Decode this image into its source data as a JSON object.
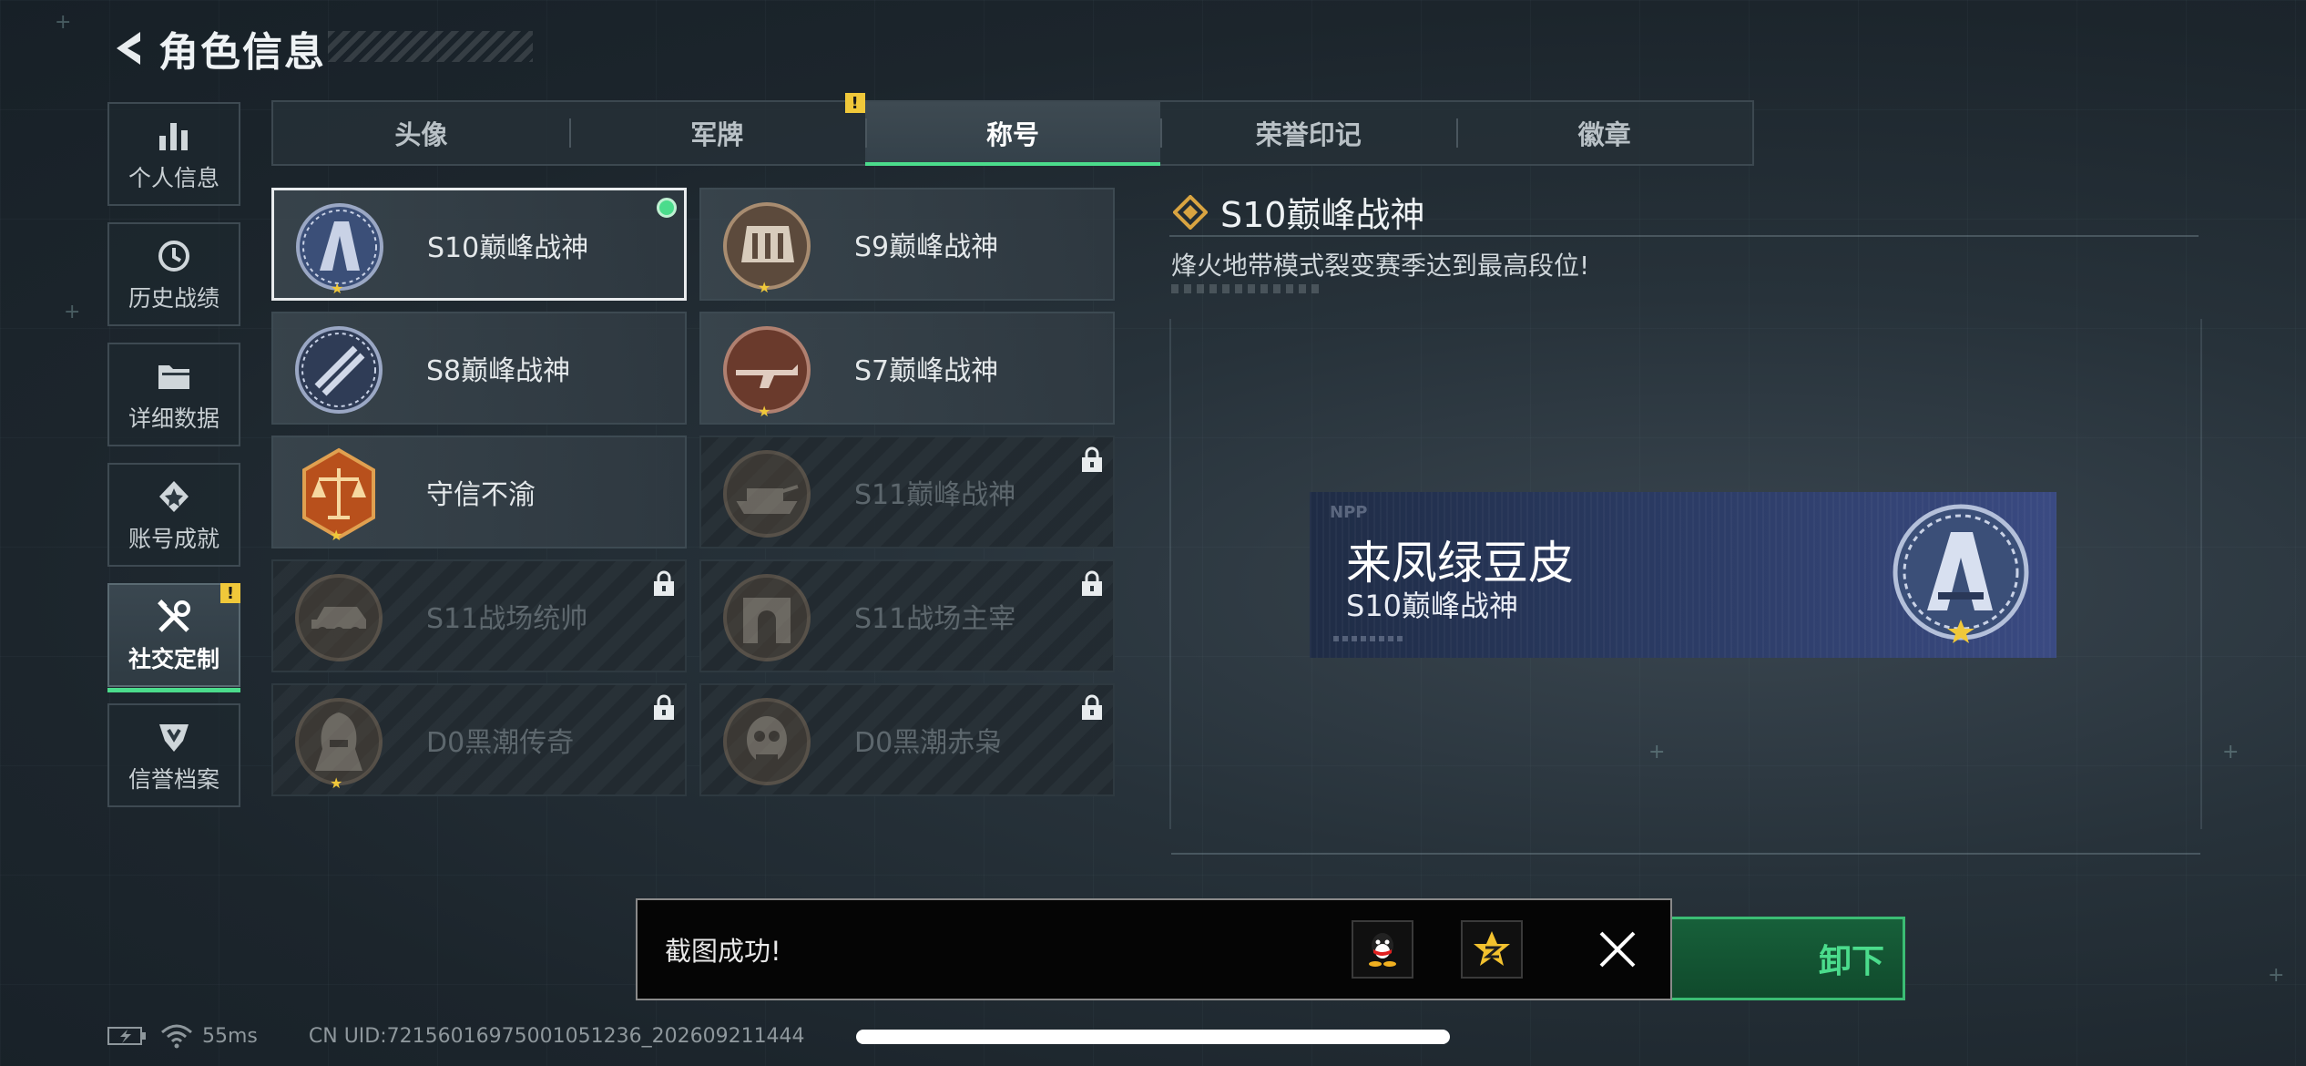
{
  "header": {
    "title": "角色信息"
  },
  "sidebar": {
    "items": [
      {
        "label": "个人信息",
        "icon": "bar-chart-icon"
      },
      {
        "label": "历史战绩",
        "icon": "clock-icon"
      },
      {
        "label": "详细数据",
        "icon": "folder-icon"
      },
      {
        "label": "账号成就",
        "icon": "achievement-icon"
      },
      {
        "label": "社交定制",
        "icon": "tools-icon",
        "active": true,
        "badge": "!"
      },
      {
        "label": "信誉档案",
        "icon": "credit-shield-icon"
      }
    ]
  },
  "tabs": [
    {
      "label": "头像"
    },
    {
      "label": "军牌",
      "badge": "!"
    },
    {
      "label": "称号",
      "active": true
    },
    {
      "label": "荣誉印记"
    },
    {
      "label": "徽章"
    }
  ],
  "titles": [
    {
      "name": "S10巅峰战神",
      "selected": true,
      "equipped": true,
      "locked": false
    },
    {
      "name": "S9巅峰战神",
      "locked": false
    },
    {
      "name": "S8巅峰战神",
      "locked": false
    },
    {
      "name": "S7巅峰战神",
      "locked": false
    },
    {
      "name": "守信不渝",
      "locked": false
    },
    {
      "name": "S11巅峰战神",
      "locked": true
    },
    {
      "name": "S11战场统帅",
      "locked": true
    },
    {
      "name": "S11战场主宰",
      "locked": true
    },
    {
      "name": "D0黑潮传奇",
      "locked": true
    },
    {
      "name": "D0黑潮赤枭",
      "locked": true
    }
  ],
  "detail": {
    "title": "S10巅峰战神",
    "description": "烽火地带模式裂变赛季达到最高段位!"
  },
  "namecard": {
    "brand": "NPP",
    "player_name": "来凤绿豆皮",
    "title": "S10巅峰战神"
  },
  "equip_button": {
    "label_visible": "卸下"
  },
  "toast": {
    "message": "截图成功!",
    "share_qq": "qq-share-icon",
    "share_qzone": "qzone-share-icon"
  },
  "status": {
    "ping": "55ms",
    "uid": "CN UID:72156016975001051236_202609211444"
  },
  "colors": {
    "accent_green": "#4bdc8c",
    "warning_yellow": "#f0c83a",
    "gold": "#d9a441"
  }
}
